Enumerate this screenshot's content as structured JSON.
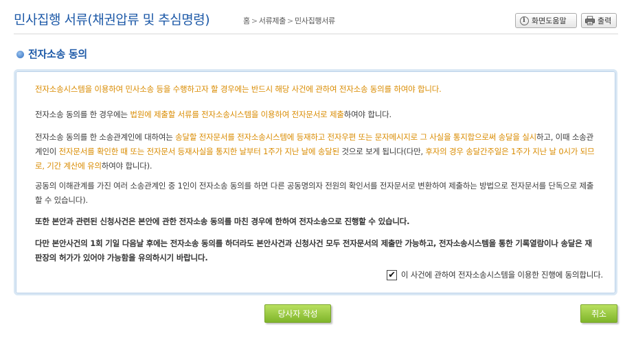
{
  "header": {
    "title": "민사집행 서류(채권압류 및 추심명령)",
    "breadcrumb": [
      "홈",
      "서류제출",
      "민사집행서류"
    ],
    "breadcrumb_sep": ">",
    "help_label": "화면도움말",
    "print_label": "출력"
  },
  "section": {
    "title": "전자소송 동의"
  },
  "consent": {
    "intro": "전자소송시스템을 이용하여 민사소송 등을 수행하고자 할 경우에는 반드시 해당 사건에 관하여 전자소송 동의를 하여야 합니다.",
    "p2_a": "전자소송 동의를 한 경우에는 ",
    "p2_hl": "법원에 제출할 서류를 전자소송시스템을 이용하여 전자문서로 제출",
    "p2_b": "하여야 합니다.",
    "p3_a": "전자소송 동의를 한 소송관계인에 대하여는 ",
    "p3_hl1": "송달할 전자문서를 전자소송시스템에 등재하고 전자우편 또는 문자메시지로 그 사실을 통지합으로써 송달을 실시",
    "p3_b": "하고, 이때 소송관계인이 ",
    "p3_hl2": "전자문서를 확인한 때 또는 전자문서 등재사실을 통지한 날부터 1주가 지난 날에 송달된",
    "p3_c": " 것으로 보게 됩니다(다만, ",
    "p3_hl3": "후자의 경우 송달간주일은 1주가 지난 날 0시가 되므로, 기간 계산에 유의",
    "p3_d": "하여야 합니다).",
    "p4": "공동의 이해관계를 가진 여러 소송관계인 중 1인이 전자소송 동의를 하면 다른 공동명의자 전원의 확인서를 전자문서로 변환하여 제출하는 방법으로 전자문서를 단독으로 제출할 수 있습니다).",
    "p5": "또한 본안과 관련된 신청사건은 본안에 관한 전자소송 동의를 마친 경우에 한하여 전자소송으로 진행할 수 있습니다.",
    "p6": "다만 본안사건의 1회 기일 다음날 후에는 전자소송 동의를 하더라도 본안사건과 신청사건 모두 전자문서의 제출만 가능하고, 전자소송시스템을 통한 기록열람이나 송달은 재판장의 허가가 있어야 가능함을 유의하시기 바랍니다.",
    "agree_label": "이 사건에 관하여 전자소송시스템을 이용한 진행에 동의합니다.",
    "agree_checked": true
  },
  "buttons": {
    "write_label": "당사자 작성",
    "cancel_label": "취소"
  },
  "colors": {
    "title_blue": "#1e5aa8",
    "highlight_orange": "#d98b00",
    "button_green": "#8ec43a",
    "panel_border": "#d9e7f4"
  },
  "icons": {
    "help": "info-icon",
    "print": "printer-icon",
    "section": "bullet-icon",
    "check": "checkmark-icon"
  }
}
